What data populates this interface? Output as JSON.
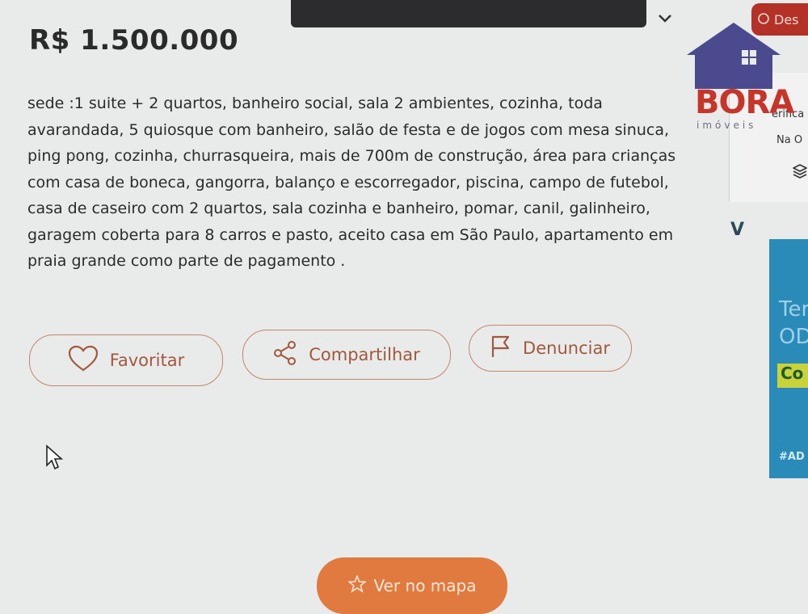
{
  "listing": {
    "price": "R$ 1.500.000",
    "description_lines": [
      "sede :1 suite + 2 quartos, banheiro social, sala 2 ambientes, cozinha, toda",
      "avarandada, 5 quiosque com banheiro, salão de festa e de jogos com mesa sinuca,",
      "ping pong, cozinha, churrasqueira, mais de 700m de construção, área para crianças",
      "com casa de boneca, gangorra, balanço e escorregador, piscina, campo de futebol,",
      "casa de caseiro com 2 quartos, sala cozinha e banheiro, pomar, canil, galinheiro,",
      "garagem coberta para 8 carros e pasto, aceito casa em São Paulo, apartamento em",
      "praia grande como parte de pagamento ."
    ]
  },
  "actions": {
    "favorite_label": "Favoritar",
    "share_label": "Compartilhar",
    "report_label": "Denunciar",
    "map_label": "Ver no mapa"
  },
  "icons": {
    "favorite": "heart-icon",
    "share": "share-icon",
    "report": "flag-icon",
    "map": "star-icon",
    "dropdown": "chevron-down-icon",
    "layers": "layers-icon",
    "cursor": "mouse-cursor-icon"
  },
  "sidebar": {
    "top_pill_label": "Des",
    "logo_text": "BORA",
    "logo_subtext": "imóveis",
    "card_text_1": "erifica",
    "card_text_2": "Na O",
    "ad_mark": "V",
    "ad_line_1": "Ter",
    "ad_line_2": "OD",
    "ad_line_3": "Co",
    "ad_tag": "#AD"
  },
  "colors": {
    "accent": "#c4856a",
    "accent_text": "#a2583d",
    "map_button": "#e07a3e",
    "brand_red": "#c6352a",
    "ad_blue": "#2a8ab8"
  }
}
